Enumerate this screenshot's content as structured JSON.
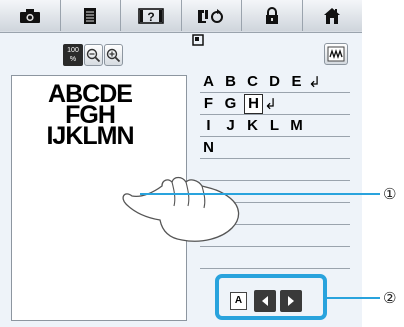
{
  "toolbar": {
    "icons": [
      "camera-icon",
      "document-icon",
      "question-film-icon",
      "embroidery-mode-icon",
      "lock-icon",
      "home-icon"
    ]
  },
  "zoom": {
    "value": "100",
    "unit": "%"
  },
  "preview": {
    "lines": [
      "ABCDE",
      "FGH",
      "IJKLMN"
    ]
  },
  "character_list": {
    "rows": [
      {
        "chars": [
          "A",
          "B",
          "C",
          "D",
          "E"
        ],
        "has_newline": true
      },
      {
        "chars": [
          "F",
          "G",
          "H"
        ],
        "has_newline": true,
        "selected_index": 2
      },
      {
        "chars": [
          "I",
          "J",
          "K",
          "L",
          "M"
        ],
        "has_newline": false
      },
      {
        "chars": [
          "N"
        ],
        "has_newline": false
      }
    ],
    "newline_symbol": "↲"
  },
  "nav": {
    "current_char": "A"
  },
  "callouts": {
    "one": "①",
    "two": "②"
  },
  "colors": {
    "highlight": "#29a3dd",
    "screen_bg": "#eef3f9"
  }
}
